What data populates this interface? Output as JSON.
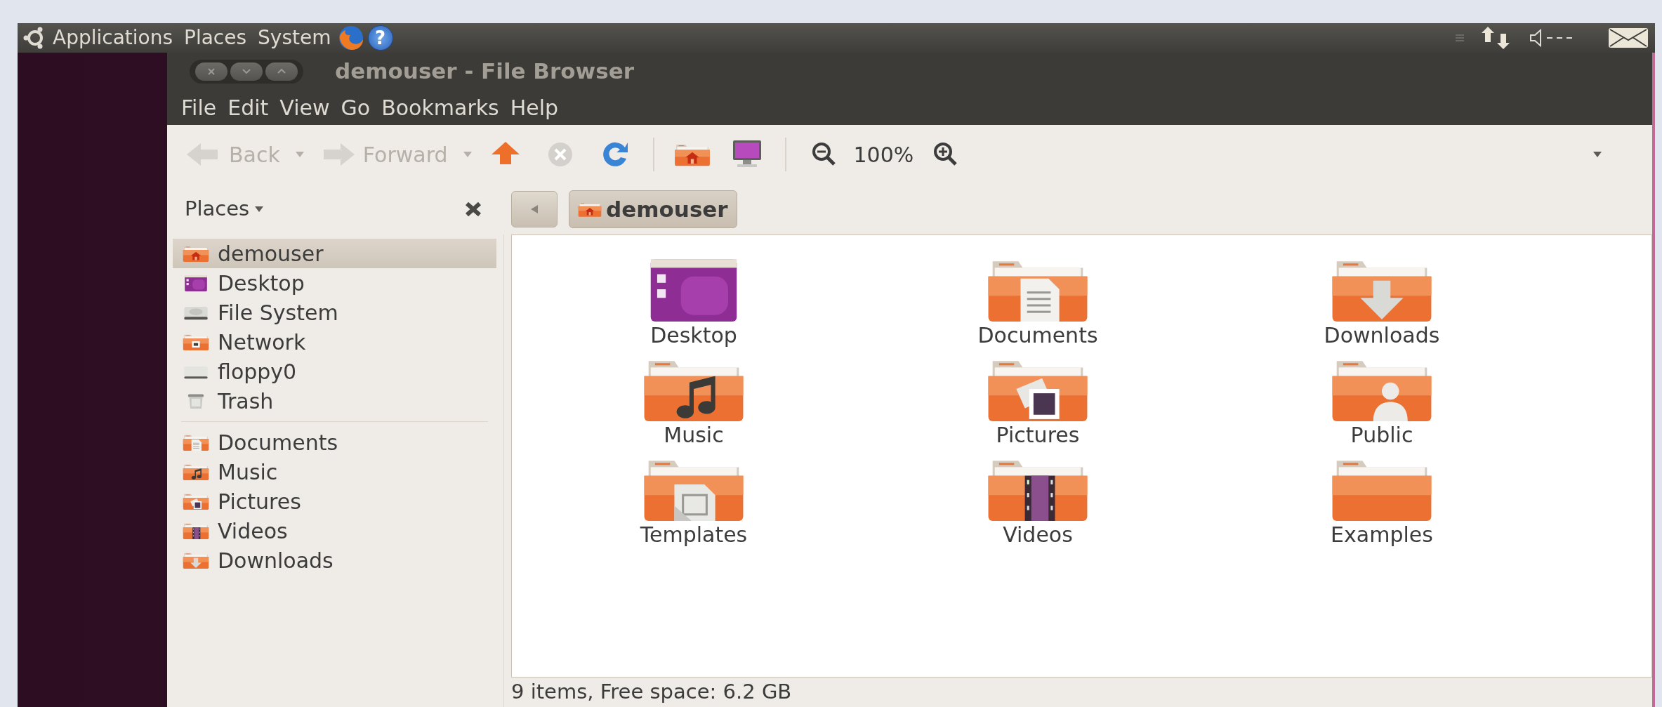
{
  "top_panel": {
    "menus": [
      "Applications",
      "Places",
      "System"
    ],
    "help_glyph": "?"
  },
  "window": {
    "title": "demouser - File Browser"
  },
  "menubar": [
    "File",
    "Edit",
    "View",
    "Go",
    "Bookmarks",
    "Help"
  ],
  "toolbar": {
    "back": {
      "label": "Back",
      "disabled": true
    },
    "forward": {
      "label": "Forward",
      "disabled": true
    },
    "stop": {
      "disabled": true
    },
    "zoom": "100%"
  },
  "side_pane": {
    "title": "Places",
    "sections": [
      [
        {
          "label": "demouser",
          "kind": "home",
          "selected": true
        },
        {
          "label": "Desktop",
          "kind": "desktop",
          "selected": false
        },
        {
          "label": "File System",
          "kind": "disk",
          "selected": false
        },
        {
          "label": "Network",
          "kind": "network",
          "selected": false
        },
        {
          "label": "floppy0",
          "kind": "floppy",
          "selected": false
        },
        {
          "label": "Trash",
          "kind": "trash",
          "selected": false
        }
      ],
      [
        {
          "label": "Documents",
          "kind": "documents",
          "selected": false
        },
        {
          "label": "Music",
          "kind": "music",
          "selected": false
        },
        {
          "label": "Pictures",
          "kind": "pictures",
          "selected": false
        },
        {
          "label": "Videos",
          "kind": "videos",
          "selected": false
        },
        {
          "label": "Downloads",
          "kind": "downloads",
          "selected": false
        }
      ]
    ]
  },
  "location": {
    "path": [
      {
        "label": "demouser",
        "selected": true
      }
    ]
  },
  "files": [
    {
      "label": "Desktop",
      "kind": "desktop"
    },
    {
      "label": "Documents",
      "kind": "documents"
    },
    {
      "label": "Downloads",
      "kind": "downloads"
    },
    {
      "label": "Music",
      "kind": "music"
    },
    {
      "label": "Pictures",
      "kind": "pictures"
    },
    {
      "label": "Public",
      "kind": "public"
    },
    {
      "label": "Templates",
      "kind": "templates"
    },
    {
      "label": "Videos",
      "kind": "videos"
    },
    {
      "label": "Examples",
      "kind": "folder"
    }
  ],
  "status_bar": "9 items, Free space: 6.2 GB"
}
